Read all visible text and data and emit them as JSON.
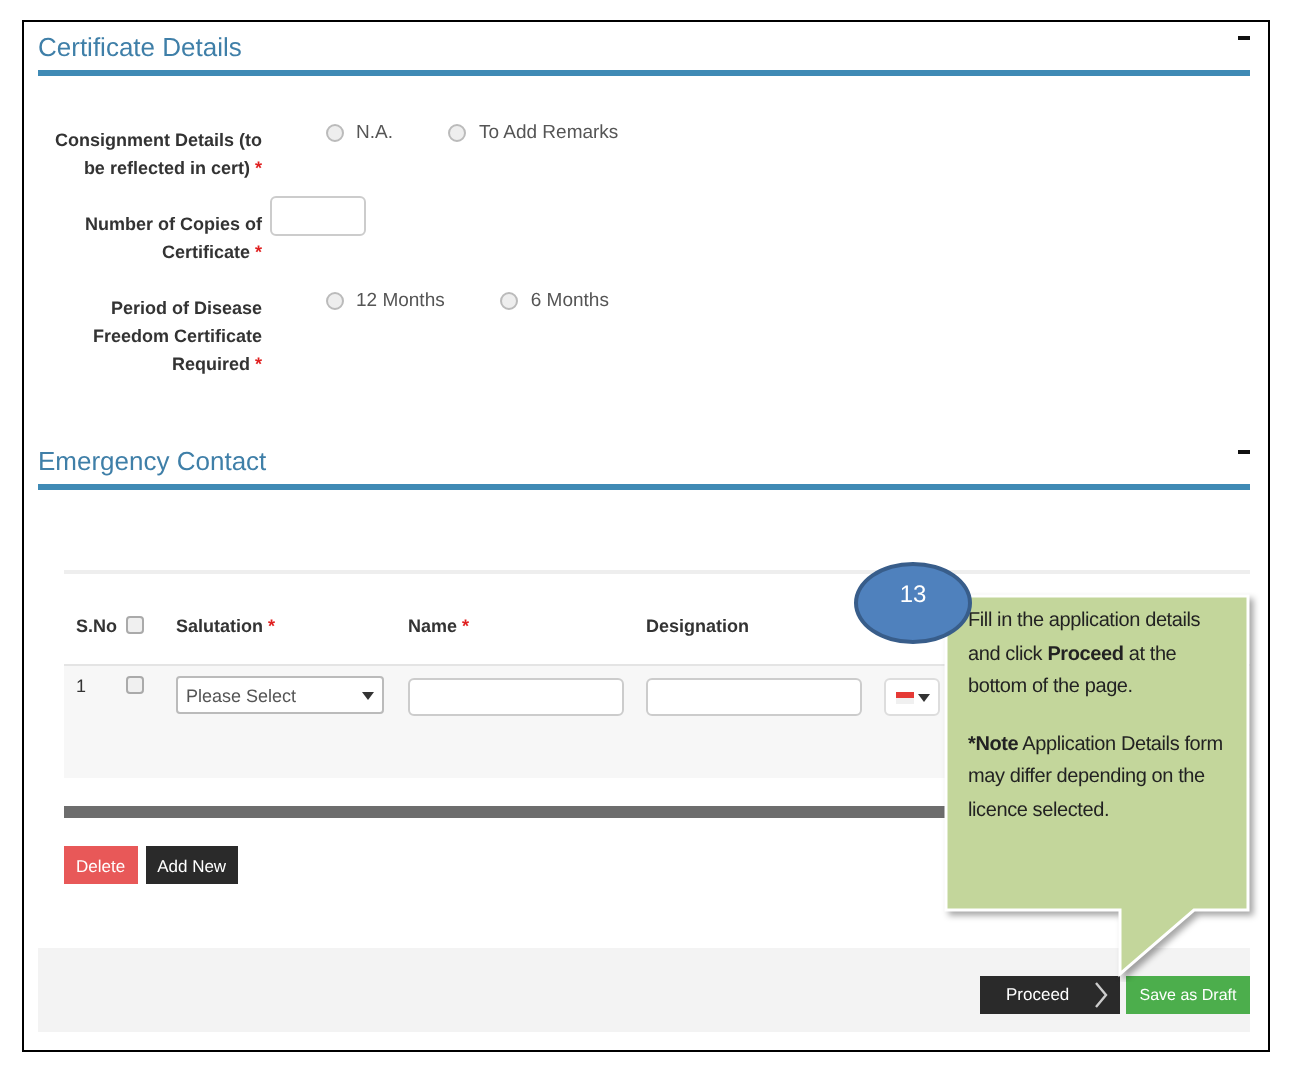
{
  "certificate_details": {
    "title": "Certificate Details",
    "fields": [
      {
        "kind": "radio",
        "label": "Consignment Details (to be reflected in cert)",
        "required_mark": "*",
        "options": [
          {
            "label": "N.A.",
            "selected": false
          },
          {
            "label": "To Add Remarks",
            "selected": false
          }
        ]
      },
      {
        "kind": "text",
        "label": "Number of Copies of Certificate",
        "required_mark": "*"
      },
      {
        "kind": "radio",
        "label": "Period of Disease Freedom Certificate Required",
        "required_mark": "*",
        "options": [
          {
            "label": "12 Months",
            "selected": false
          },
          {
            "label": "6 Months",
            "selected": false
          }
        ]
      }
    ]
  },
  "emergency_contact": {
    "title": "Emergency Contact",
    "table": {
      "sno_header": "S.No",
      "select_all_checked": false,
      "columns": [
        {
          "label": "Salutation",
          "required_mark": "*"
        },
        {
          "label": "Name",
          "required_mark": "*"
        },
        {
          "label": "Designation"
        }
      ],
      "rows": [
        {
          "sno": "1",
          "checked": false,
          "salutation": "Please Select"
        }
      ]
    },
    "buttons": [
      {
        "kind": "danger",
        "label": "Delete"
      },
      {
        "kind": "dark",
        "label": "Add New"
      }
    ]
  },
  "footer_buttons": [
    {
      "kind": "proceed",
      "label": "Proceed"
    },
    {
      "kind": "success",
      "label": "Save as Draft"
    }
  ],
  "callout": {
    "step": "13",
    "text": "Fill in the application details and click **Proceed** at the bottom of the page.",
    "note_label": "*Note",
    "note_text": "Application Details form may differ depending on the licence selected."
  }
}
